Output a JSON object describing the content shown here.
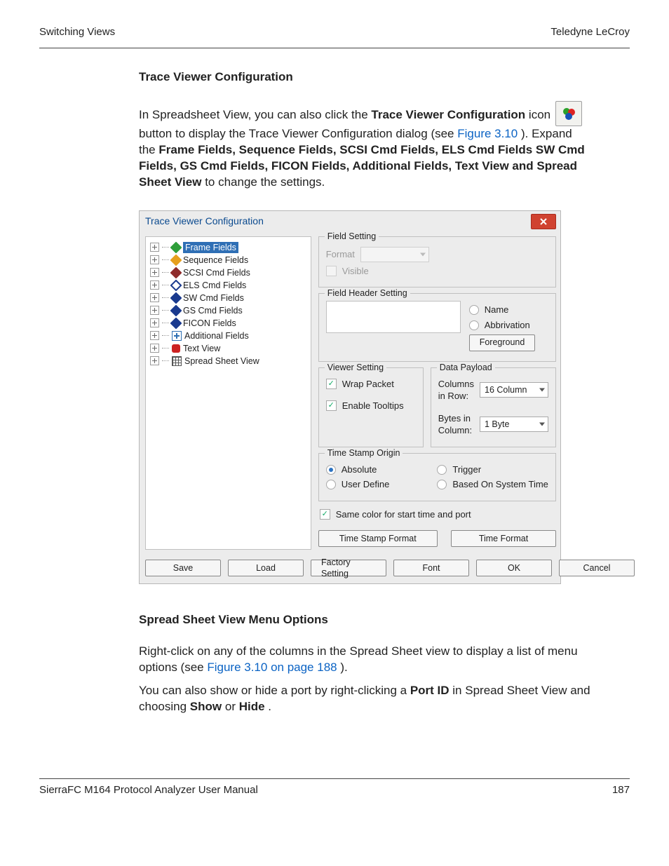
{
  "header": {
    "left": "Switching Views",
    "right": "Teledyne LeCroy"
  },
  "section1": {
    "title": "Trace Viewer Configuration",
    "p1a": "In Spreadsheet View, you can also click the ",
    "p1b": "Trace Viewer Configuration",
    "p1c": " icon ",
    "p1d": " button to display the Trace Viewer Configuration dialog (see ",
    "figref": "Figure 3.10",
    "p1e": "). Expand the ",
    "p1f": "Frame Fields, Sequence Fields, SCSI Cmd Fields, ELS Cmd Fields SW Cmd Fields, GS Cmd Fields, FICON Fields, Additional Fields, Text View and Spread Sheet View",
    "p1g": " to change the settings."
  },
  "dialog": {
    "title": "Trace Viewer Configuration",
    "close": "x",
    "tree": [
      "Frame Fields",
      "Sequence Fields",
      "SCSI Cmd Fields",
      "ELS Cmd Fields",
      "SW Cmd Fields",
      "GS Cmd Fields",
      "FICON Fields",
      "Additional Fields",
      "Text View",
      "Spread Sheet View"
    ],
    "fieldSetting": {
      "legend": "Field Setting",
      "format": "Format",
      "visible": "Visible"
    },
    "headerSetting": {
      "legend": "Field Header Setting",
      "name": "Name",
      "abbr": "Abbrivation",
      "foreground": "Foreground"
    },
    "viewer": {
      "legend": "Viewer Setting",
      "wrap": "Wrap Packet",
      "tooltips": "Enable Tooltips"
    },
    "payload": {
      "legend": "Data Payload",
      "colsLabel": "Columns in Row:",
      "colsValue": "16  Column",
      "bytesLabel": "Bytes in Column:",
      "bytesValue": "1   Byte"
    },
    "tso": {
      "legend": "Time Stamp Origin",
      "absolute": "Absolute",
      "trigger": "Trigger",
      "user": "User Define",
      "system": "Based On System Time",
      "sameColor": "Same color for start time and port",
      "tsFormat": "Time Stamp Format",
      "tFormat": "Time Format"
    },
    "buttons": {
      "save": "Save",
      "load": "Load",
      "factory": "Factory Setting",
      "font": "Font",
      "ok": "OK",
      "cancel": "Cancel"
    }
  },
  "section2": {
    "title": "Spread Sheet View Menu Options",
    "p1a": "Right-click on any of the columns in the Spread Sheet view to display a list of menu options (see ",
    "figref": "Figure 3.10 on page 188",
    "p1b": ").",
    "p2a": "You can also show or hide a port by right-clicking a ",
    "p2b": "Port ID",
    "p2c": " in Spread Sheet View and choosing ",
    "p2d": "Show",
    "p2e": " or ",
    "p2f": "Hide",
    "p2g": "."
  },
  "footer": {
    "left": "SierraFC M164 Protocol Analyzer User Manual",
    "right": "187"
  }
}
